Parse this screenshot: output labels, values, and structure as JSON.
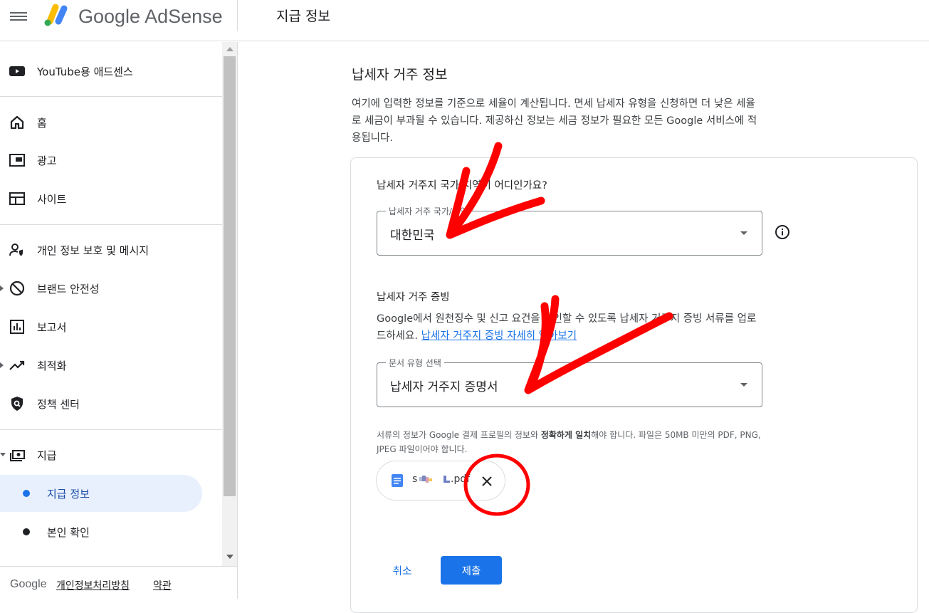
{
  "app": {
    "brand": "Google AdSense",
    "page_title": "지급 정보"
  },
  "colors": {
    "accent": "#1a73e8",
    "annotation": "#ff0000",
    "active_bg": "#e8f0fe"
  },
  "sidebar": {
    "items": [
      {
        "label": "YouTube용 애드센스",
        "icon": "youtube-icon"
      },
      {
        "label": "홈",
        "icon": "home-icon"
      },
      {
        "label": "광고",
        "icon": "ads-icon"
      },
      {
        "label": "사이트",
        "icon": "sites-icon"
      },
      {
        "label": "개인 정보 보호 및 메시지",
        "icon": "privacy-icon"
      },
      {
        "label": "브랜드 안전성",
        "icon": "block-icon"
      },
      {
        "label": "보고서",
        "icon": "reports-icon"
      },
      {
        "label": "최적화",
        "icon": "trending-icon"
      },
      {
        "label": "정책 센터",
        "icon": "policy-shield-icon"
      },
      {
        "label": "지급",
        "icon": "payments-icon"
      }
    ],
    "sub_items": [
      {
        "label": "지급 정보",
        "active": true
      },
      {
        "label": "본인 확인",
        "active": false
      }
    ]
  },
  "footer": {
    "google": "Google",
    "privacy": "개인정보처리방침",
    "terms": "약관"
  },
  "main": {
    "title": "납세자 거주 정보",
    "description": "여기에 입력한 정보를 기준으로 세율이 계산됩니다. 면세 납세자 유형을 신청하면 더 낮은 세율로 세금이 부과될 수 있습니다. 제공하신 정보는 세금 정보가 필요한 모든 Google 서비스에 적용됩니다.",
    "country_question": "납세자 거주지 국가/지역이 어디인가요?",
    "country_field": {
      "label": "납세자 거주 국가/지역",
      "value": "대한민국"
    },
    "proof_title": "납세자 거주 증빙",
    "proof_desc": "Google에서 원천징수 및 신고 요건을 확인할 수 있도록 납세자 거주지 증빙 서류를 업로드하세요. ",
    "proof_link": "납세자 거주지 증빙 자세히 알아보기",
    "doc_type_field": {
      "label": "문서 유형 선택",
      "value": "납세자 거주지 증명서"
    },
    "note_pre": "서류의 정보가 Google 결제 프로필의 정보와 ",
    "note_bold": "정확하게 일치",
    "note_post": "해야 합니다. 파일은 50MB 미만의 PDF, PNG, JPEG 파일이어야 합니다.",
    "file_chip": {
      "name_prefix": "s",
      "name_suffix": ".pdf"
    },
    "cancel": "취소",
    "submit": "제출"
  }
}
